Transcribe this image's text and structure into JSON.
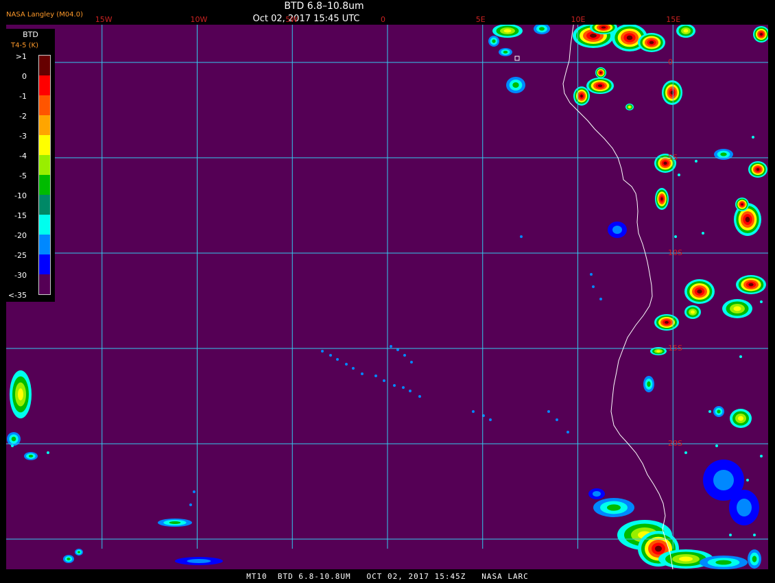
{
  "header": {
    "provider": "NASA Langley (M04.0)",
    "title": "BTD 6.8–10.8um",
    "subtitle": "Oct 02, 2017 15:45 UTC"
  },
  "legend": {
    "title": "BTD",
    "subtitle": "T4-5 (K)",
    "entries": [
      {
        "label": ">1",
        "color": "#660000"
      },
      {
        "label": "0",
        "color": "#ff0000"
      },
      {
        "label": "-1",
        "color": "#ff5500"
      },
      {
        "label": "-2",
        "color": "#ffa500"
      },
      {
        "label": "-3",
        "color": "#ffff00"
      },
      {
        "label": "-4",
        "color": "#99ee00"
      },
      {
        "label": "-5",
        "color": "#00bb00"
      },
      {
        "label": "-10",
        "color": "#008866"
      },
      {
        "label": "-15",
        "color": "#00ffee"
      },
      {
        "label": "-20",
        "color": "#0088ff"
      },
      {
        "label": "-25",
        "color": "#0000ff"
      },
      {
        "label": "-30",
        "color": "#550055"
      },
      {
        "label": "<-35",
        "color": ""
      }
    ]
  },
  "grid": {
    "longitudes": [
      {
        "label": "15W",
        "deg": -15
      },
      {
        "label": "10W",
        "deg": -10
      },
      {
        "label": "5W",
        "deg": -5
      },
      {
        "label": "0",
        "deg": 0
      },
      {
        "label": "5E",
        "deg": 5
      },
      {
        "label": "10E",
        "deg": 10
      },
      {
        "label": "15E",
        "deg": 15
      }
    ],
    "latitudes": [
      {
        "label": "0",
        "deg": 0
      },
      {
        "label": "5S",
        "deg": -5
      },
      {
        "label": "10S",
        "deg": -10
      },
      {
        "label": "15S",
        "deg": -15
      },
      {
        "label": "20S",
        "deg": -20
      },
      {
        "label": "25S",
        "deg": -25
      }
    ],
    "line_color": "#33ccee"
  },
  "map": {
    "background_color": "#550055",
    "coastline_color": "#ffffff"
  },
  "footer": {
    "text": "MT10  BTD 6.8-10.8UM   OCT 02, 2017 15:45Z   NASA LARC"
  }
}
